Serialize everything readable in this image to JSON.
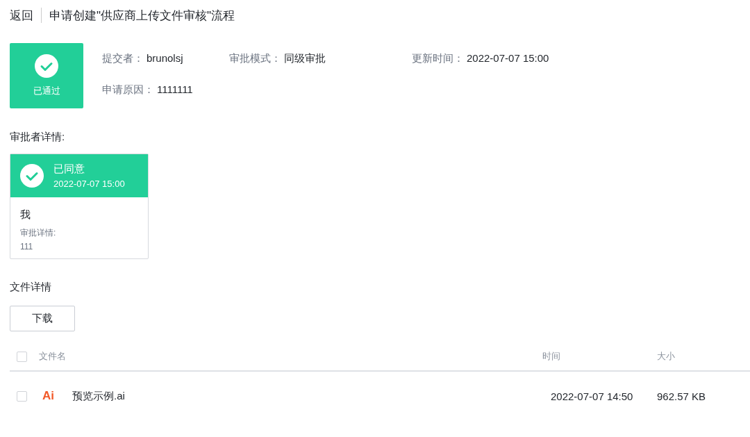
{
  "header": {
    "back": "返回",
    "title": "申请创建\"供应商上传文件审核\"流程"
  },
  "status": {
    "label": "已通过",
    "approved": true
  },
  "info": [
    {
      "label": "提交者：",
      "value": "brunolsj"
    },
    {
      "label": "审批模式：",
      "value": "同级审批"
    },
    {
      "label": "更新时间：",
      "value": "2022-07-07 15:00"
    },
    {
      "label": "申请原因：",
      "value": "1111111"
    }
  ],
  "approvers_title": "审批者详情:",
  "approvers": [
    {
      "status": "已同意",
      "approved": true,
      "time": "2022-07-07 15:00",
      "name": "我",
      "detail_label": "审批详情:",
      "detail": "111"
    }
  ],
  "files_title": "文件详情",
  "download": "下载",
  "table": {
    "columns": [
      "文件名",
      "时间",
      "大小"
    ],
    "all_checked": false,
    "rows": [
      {
        "checked": false,
        "type_label": "Ai",
        "name": "预览示例.ai",
        "time": "2022-07-07 14:50",
        "size": "962.57 KB"
      }
    ]
  }
}
